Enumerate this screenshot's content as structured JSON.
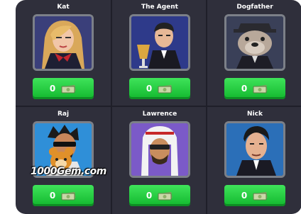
{
  "characters": [
    {
      "name": "Kat",
      "balance": "0"
    },
    {
      "name": "The Agent",
      "balance": "0"
    },
    {
      "name": "Dogfather",
      "balance": "0"
    },
    {
      "name": "Raj",
      "balance": "0"
    },
    {
      "name": "Lawrence",
      "balance": "0"
    },
    {
      "name": "Nick",
      "balance": "0"
    }
  ],
  "watermark": "1000Gem.com",
  "colors": {
    "panel": "#2f2f3b",
    "button": "#22c93e",
    "frame": "#7c8088"
  },
  "icons": {
    "currency": "cash-bill-icon"
  }
}
